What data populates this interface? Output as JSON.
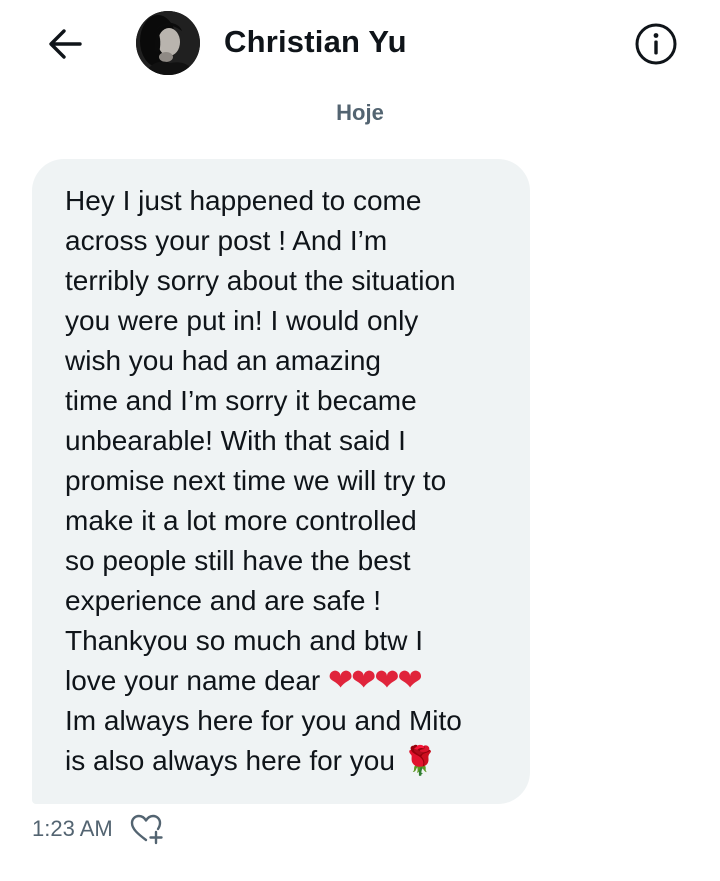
{
  "header": {
    "contact_name": "Christian Yu"
  },
  "conversation": {
    "date_label": "Hoje",
    "message": {
      "lines": [
        "Hey I just happened to come",
        "across your post ! And I’m",
        "terribly sorry about the situation",
        "you were put in! I would only",
        "wish you had an amazing",
        "time and I’m sorry it became",
        "unbearable! With that said I",
        "promise next time we will try to",
        "make it a lot more controlled",
        "so people still have the best",
        "experience and are safe !",
        "Thankyou so much and btw I",
        "love your name dear",
        "Im always here for you and Mito",
        "is also always here for you"
      ],
      "hearts": "❤❤❤❤",
      "rose": "🌹",
      "timestamp": "1:23 AM"
    }
  },
  "icons": {
    "back": "arrow-left-icon",
    "info": "info-circle-icon",
    "react": "heart-plus-icon"
  },
  "colors": {
    "bubble_bg": "#eff3f4",
    "text": "#0f1419",
    "secondary_text": "#536471",
    "heart": "#e0243b"
  }
}
